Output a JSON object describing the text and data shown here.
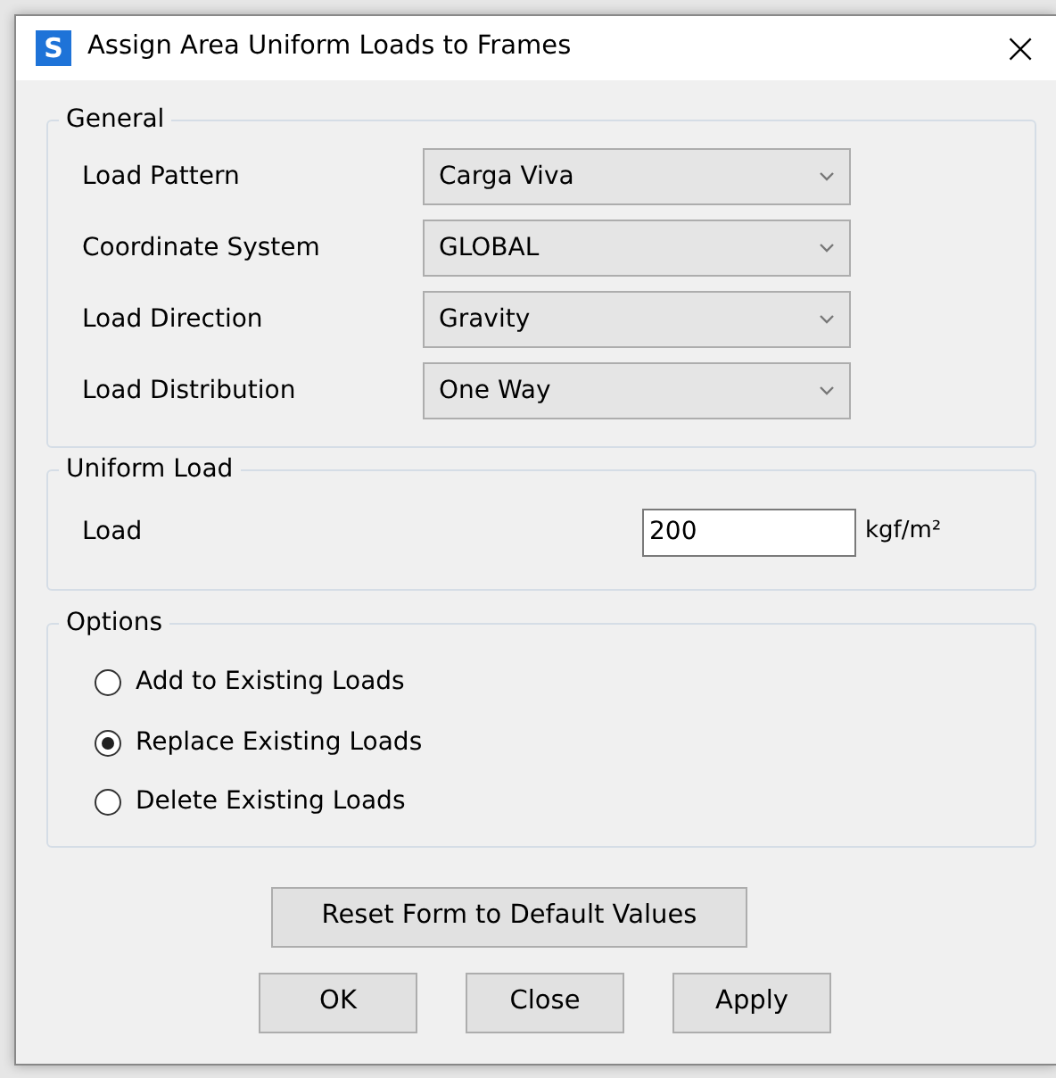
{
  "window": {
    "title": "Assign Area Uniform Loads to Frames",
    "app_icon": "S",
    "close": "×"
  },
  "general": {
    "title": "General",
    "fields": [
      {
        "label": "Load Pattern",
        "value": "Carga Viva"
      },
      {
        "label": "Coordinate System",
        "value": "GLOBAL"
      },
      {
        "label": "Load Direction",
        "value": "Gravity"
      },
      {
        "label": "Load Distribution",
        "value": "One Way"
      }
    ]
  },
  "uniform_load": {
    "title": "Uniform Load",
    "label": "Load",
    "value": "200",
    "unit": "kgf/m²"
  },
  "options": {
    "title": "Options",
    "items": [
      {
        "label": "Add to Existing Loads",
        "selected": false
      },
      {
        "label": "Replace Existing Loads",
        "selected": true
      },
      {
        "label": "Delete Existing Loads",
        "selected": false
      }
    ]
  },
  "reset_button": "Reset Form to Default Values",
  "buttons": [
    "OK",
    "Close",
    "Apply"
  ]
}
